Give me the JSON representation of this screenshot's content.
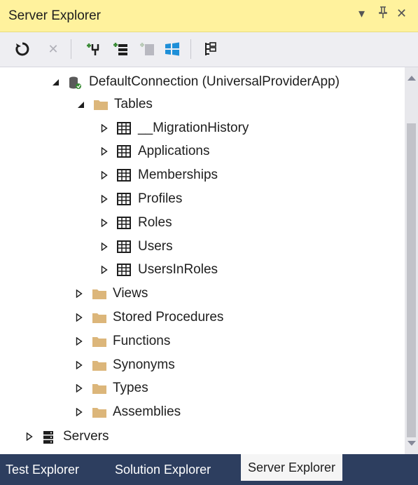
{
  "window": {
    "title": "Server Explorer",
    "dropdown_glyph": "▾",
    "pin_glyph": "ᚙ",
    "close_glyph": "✕"
  },
  "toolbar": {
    "icons": [
      "refresh-icon",
      "stop-icon",
      "connect-to-database-icon",
      "connect-to-server-icon",
      "connect-to-sharepoint-icon",
      "connect-to-azure-icon",
      "properties-icon"
    ]
  },
  "tree": {
    "connection": {
      "label": "DefaultConnection (UniversalProviderApp)",
      "expanded": true
    },
    "tables": {
      "label": "Tables",
      "expanded": true,
      "items": [
        "__MigrationHistory",
        "Applications",
        "Memberships",
        "Profiles",
        "Roles",
        "Users",
        "UsersInRoles"
      ]
    },
    "folders": [
      "Views",
      "Stored Procedures",
      "Functions",
      "Synonyms",
      "Types",
      "Assemblies"
    ],
    "servers": {
      "label": "Servers",
      "expanded": false
    }
  },
  "tabs": [
    {
      "label": "Test Explorer",
      "active": false
    },
    {
      "label": "Solution Explorer",
      "active": false
    },
    {
      "label": "Server Explorer",
      "active": true
    }
  ],
  "colors": {
    "title_bg": "#fff29d",
    "toolbar_bg": "#eeeef2",
    "folder": "#dcb67a",
    "tabbar_bg": "#2d3e5f",
    "accent_green": "#388a34"
  }
}
